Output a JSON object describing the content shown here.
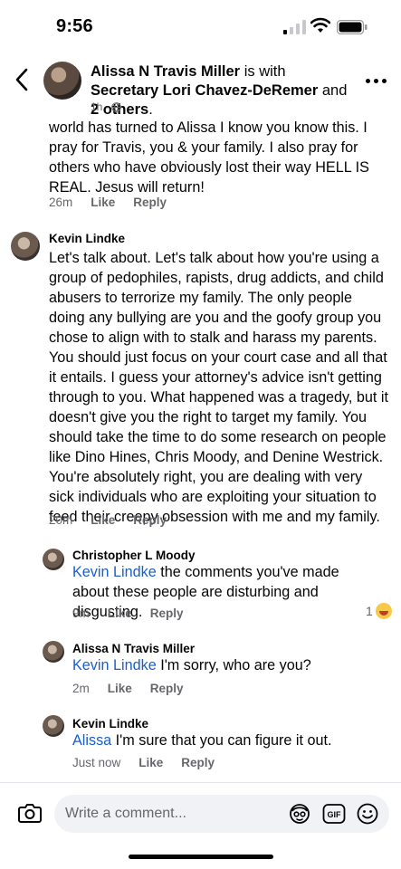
{
  "status_bar": {
    "time": "9:56"
  },
  "header": {
    "author": "Alissa N Travis Miller",
    "with_text": "is with",
    "tagged": "Secretary Lori Chavez-DeRemer",
    "and_text": "and",
    "others": "2 others",
    "end": ".",
    "time": "1h",
    "dot": "·"
  },
  "comments": [
    {
      "text": "world has turned to Alissa I know you know this. I pray for Travis, you & your family. I also pray for others who have obviously lost their way HELL IS REAL. Jesus will return!",
      "time": "26m",
      "like": "Like",
      "reply": "Reply"
    },
    {
      "name": "Kevin Lindke",
      "text": "Let's talk about. Let's talk about how you're using a group of pedophiles, rapists, drug addicts, and child abusers to terrorize my family. The only people doing any bullying are you and the goofy group you chose to align with to stalk and harass my parents. You should just focus on your court case and all that it entails. I guess your attorney's advice isn't getting through to you. What happened was a tragedy, but it doesn't give you the right to target my family. You should take the time to do some research on people like Dino Hines, Chris Moody, and Denine Westrick. You're absolutely right, you are dealing with very sick individuals who are exploiting your situation to feed their creepy obsession with me and my family.",
      "time": "20m",
      "like": "Like",
      "reply": "Reply"
    }
  ],
  "replies": [
    {
      "name": "Christopher L Moody",
      "mention": "Kevin Lindke",
      "text": " the comments you've made about these people are disturbing and disgusting.",
      "time": "9m",
      "like": "Like",
      "reply": "Reply",
      "reaction_count": "1"
    },
    {
      "name": "Alissa N Travis Miller",
      "mention": "Kevin Lindke",
      "text": " I'm sorry, who are you?",
      "time": "2m",
      "like": "Like",
      "reply": "Reply"
    },
    {
      "name": "Kevin Lindke",
      "mention": "Alissa",
      "text": " I'm sure that you can figure it out.",
      "time": "Just now",
      "like": "Like",
      "reply": "Reply"
    }
  ],
  "composer": {
    "placeholder": "Write a comment...",
    "gif_label": "GIF"
  },
  "icons": [
    "back-icon",
    "more-icon",
    "globe-icon",
    "camera-icon",
    "avatar-sticker-icon",
    "gif-icon",
    "emoji-icon",
    "laughing-emoji-icon"
  ]
}
